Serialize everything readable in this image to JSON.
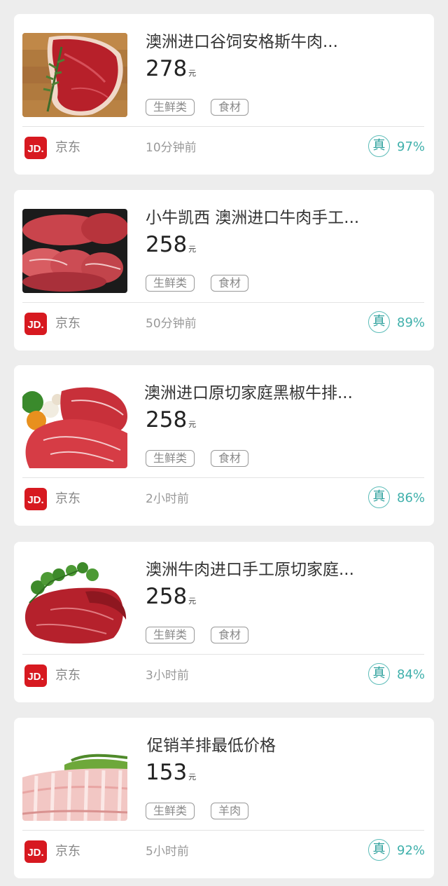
{
  "colors": {
    "background": "#ededed",
    "card": "#ffffff",
    "accent_teal": "#3fb0ab",
    "jd_red": "#d71920"
  },
  "icons": {
    "store_logo": "jd-logo-icon",
    "authenticity_badge": "true-badge-icon"
  },
  "items": [
    {
      "title": "澳洲进口谷饲安格斯牛肉...",
      "price": "278",
      "unit": "元",
      "tags": [
        "生鲜类",
        "食材"
      ],
      "store_logo_text": "JD.",
      "store": "京东",
      "time": "10分钟前",
      "badge": "真",
      "rate": "97%"
    },
    {
      "title": "小牛凯西 澳洲进口牛肉手工...",
      "price": "258",
      "unit": "元",
      "tags": [
        "生鲜类",
        "食材"
      ],
      "store_logo_text": "JD.",
      "store": "京东",
      "time": "50分钟前",
      "badge": "真",
      "rate": "89%"
    },
    {
      "title": "澳洲进口原切家庭黑椒牛排...",
      "price": "258",
      "unit": "元",
      "tags": [
        "生鲜类",
        "食材"
      ],
      "store_logo_text": "JD.",
      "store": "京东",
      "time": "2小时前",
      "badge": "真",
      "rate": "86%"
    },
    {
      "title": "澳洲牛肉进口手工原切家庭...",
      "price": "258",
      "unit": "元",
      "tags": [
        "生鲜类",
        "食材"
      ],
      "store_logo_text": "JD.",
      "store": "京东",
      "time": "3小时前",
      "badge": "真",
      "rate": "84%"
    },
    {
      "title": "促销羊排最低价格",
      "price": "153",
      "unit": "元",
      "tags": [
        "生鲜类",
        "羊肉"
      ],
      "store_logo_text": "JD.",
      "store": "京东",
      "time": "5小时前",
      "badge": "真",
      "rate": "92%"
    }
  ]
}
